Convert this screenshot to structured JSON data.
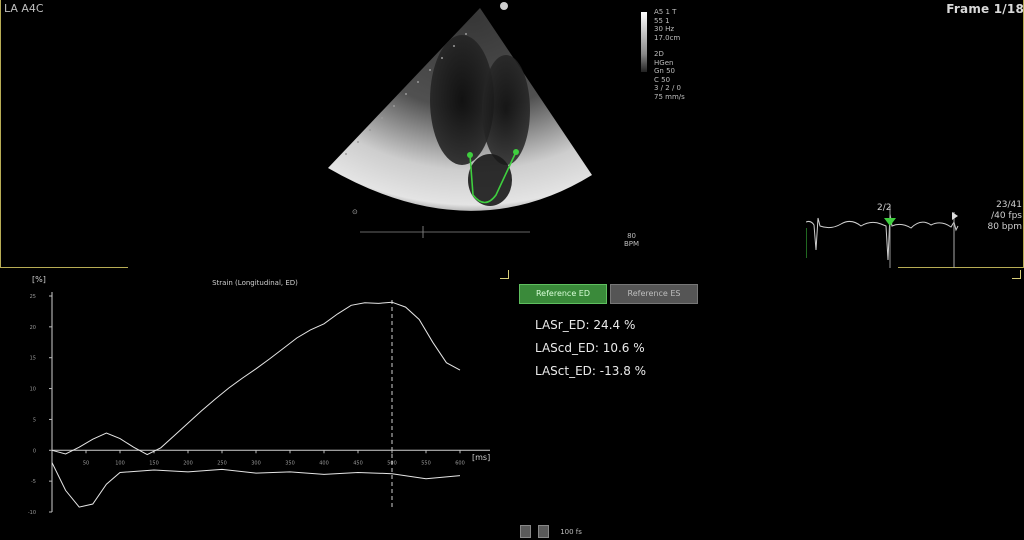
{
  "viewer": {
    "view_label": "LA A4C",
    "frame_label": "Frame 1/18"
  },
  "acquisition": {
    "lines": [
      "A5 1 T",
      "55 1",
      "30 Hz",
      "17.0cm",
      "",
      "2D",
      "HGen",
      "Gn 50",
      "C 50",
      "3 / 2 / 0",
      "75 mm/s"
    ]
  },
  "heart_rate": {
    "value": "80",
    "unit": "BPM"
  },
  "ecg": {
    "beat_label": "2/2",
    "frame_counter": "23/41",
    "fps": "/40 fps",
    "bpm": "80 bpm"
  },
  "buttons": {
    "reference_ed": "Reference ED",
    "reference_es": "Reference ES"
  },
  "measurements": [
    {
      "label": "LASr_ED:",
      "value": "24.4 %"
    },
    {
      "label": "LAScd_ED:",
      "value": "10.6 %"
    },
    {
      "label": "LASct_ED:",
      "value": "-13.8 %"
    }
  ],
  "bottom": {
    "fps_text": "100 fs"
  },
  "colors": {
    "accent_yellow": "#b8ad55",
    "ed_button_green": "#3a8a3a",
    "trace_green": "#3fcf3f"
  },
  "chart_data": {
    "type": "line",
    "title": "Strain (Longitudinal, ED)",
    "ylabel": "[%]",
    "xlabel": "[ms]",
    "ylim": [
      -10,
      25
    ],
    "xlim": [
      0,
      600
    ],
    "y_ticks": [
      25,
      20,
      15,
      10,
      5,
      0,
      -5,
      -10
    ],
    "x_ticks": [
      50,
      100,
      150,
      200,
      250,
      300,
      350,
      400,
      450,
      500,
      550,
      600
    ],
    "marker_x": 500,
    "series": [
      {
        "x": [
          0,
          20,
          40,
          60,
          80,
          100,
          120,
          140,
          160,
          180,
          200,
          220,
          240,
          260,
          280,
          300,
          320,
          340,
          360,
          380,
          400,
          420,
          440,
          460,
          480,
          500,
          520,
          540,
          560,
          580,
          600
        ],
        "y": [
          0,
          -0.6,
          0.5,
          1.8,
          2.8,
          1.9,
          0.5,
          -0.7,
          0.4,
          2.4,
          4.4,
          6.4,
          8.3,
          10.1,
          11.7,
          13.2,
          14.8,
          16.5,
          18.2,
          19.5,
          20.5,
          22.1,
          23.5,
          23.9,
          23.8,
          24.0,
          23.2,
          21.2,
          17.5,
          14.2,
          13.0
        ]
      },
      {
        "x": [
          0,
          20,
          40,
          60,
          80,
          100,
          150,
          200,
          250,
          300,
          350,
          400,
          450,
          500,
          550,
          600
        ],
        "y": [
          -2,
          -6.5,
          -9.2,
          -8.7,
          -5.5,
          -3.6,
          -3.2,
          -3.5,
          -3.1,
          -3.7,
          -3.5,
          -3.9,
          -3.6,
          -3.8,
          -4.6,
          -4.1
        ]
      }
    ]
  }
}
